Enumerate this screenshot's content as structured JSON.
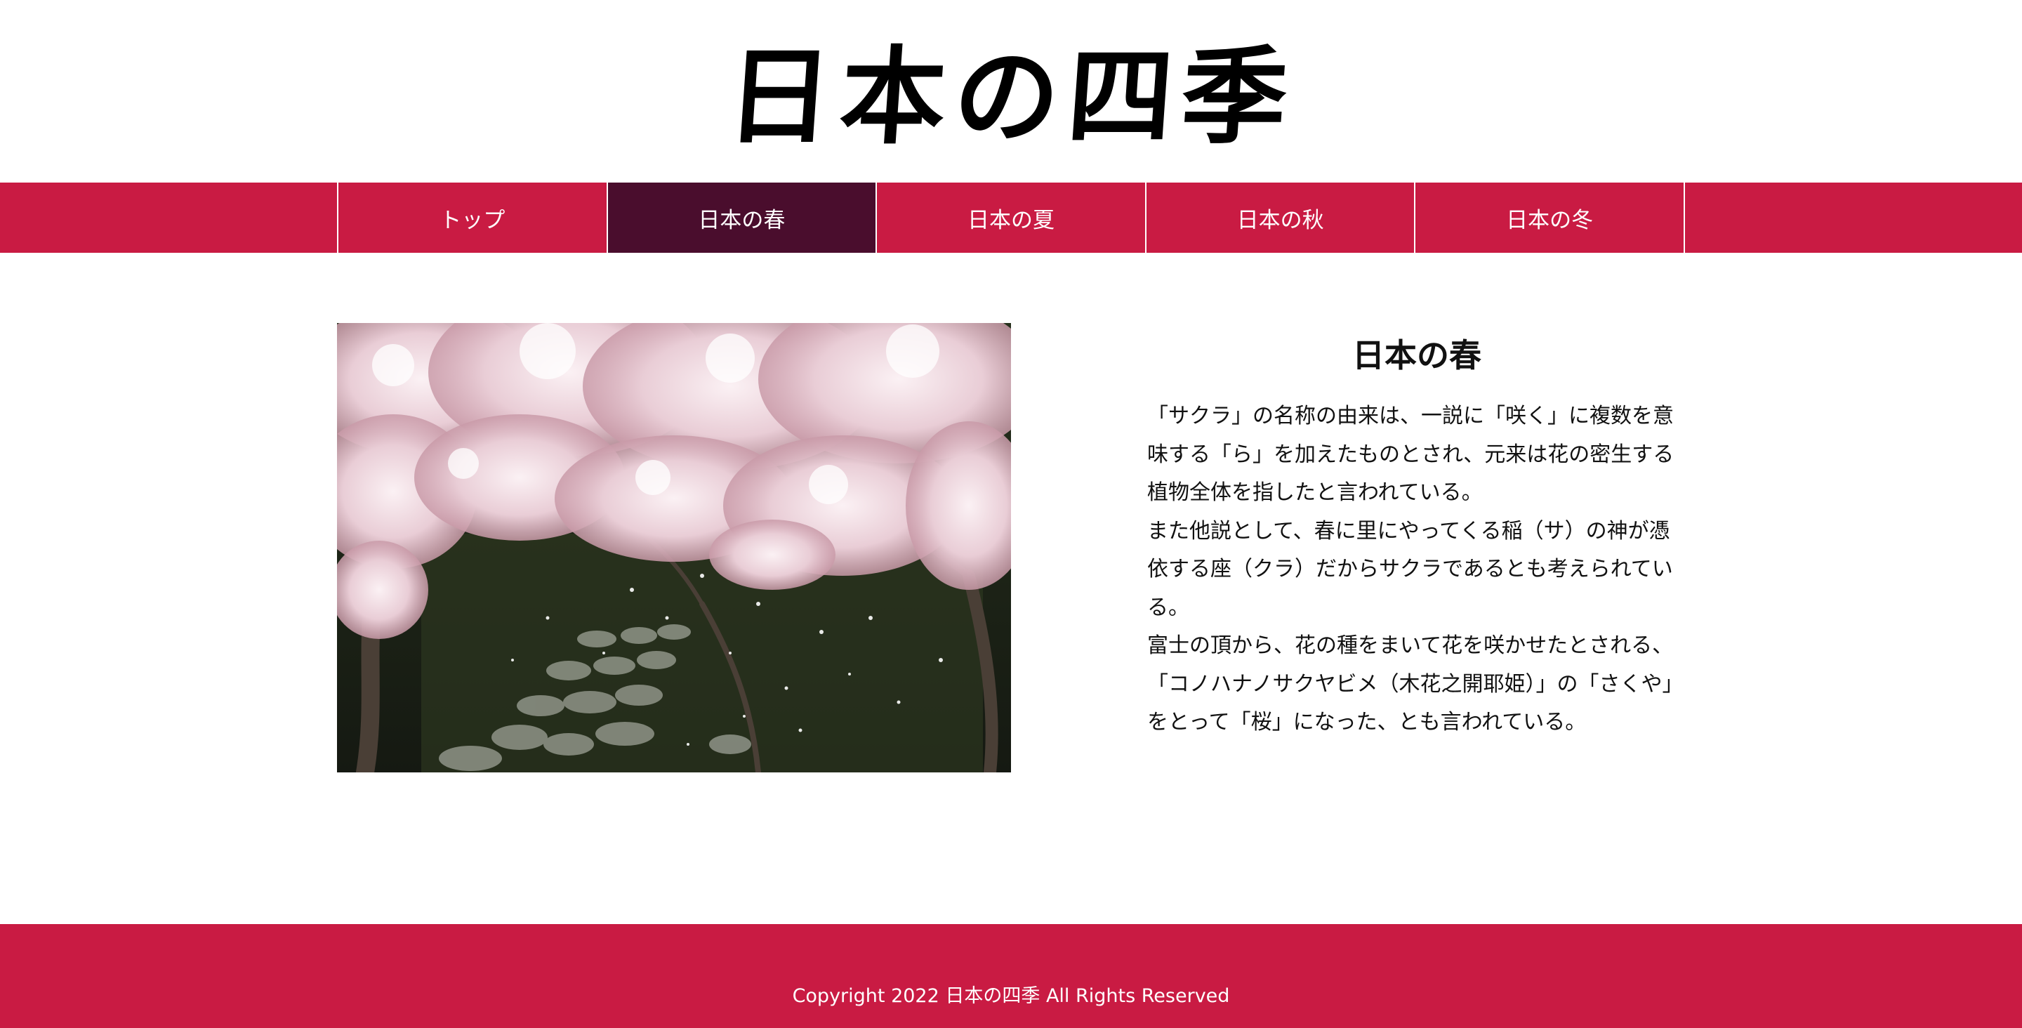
{
  "header": {
    "logo_text": "日本の四季"
  },
  "nav": {
    "items": [
      {
        "label": "トップ",
        "active": false
      },
      {
        "label": "日本の春",
        "active": true
      },
      {
        "label": "日本の夏",
        "active": false
      },
      {
        "label": "日本の秋",
        "active": false
      },
      {
        "label": "日本の冬",
        "active": false
      }
    ]
  },
  "main": {
    "image": {
      "icon": "cherry-blossom-photo"
    },
    "title": "日本の春",
    "paragraphs": [
      "「サクラ」の名称の由来は、一説に「咲く」に複数を意味する「ら」を加えたものとされ、元来は花の密生する植物全体を指したと言われている。",
      "また他説として、春に里にやってくる稲（サ）の神が憑依する座（クラ）だからサクラであるとも考えられている。",
      "富士の頂から、花の種をまいて花を咲かせたとされる、「コノハナノサクヤビメ（木花之開耶姫）」の「さくや」をとって「桜」になった、とも言われている。"
    ]
  },
  "footer": {
    "copyright": "Copyright 2022 日本の四季 All Rights Reserved"
  },
  "colors": {
    "brand": "#c91b43",
    "nav_active": "#4a0d2d",
    "text": "#111111"
  }
}
